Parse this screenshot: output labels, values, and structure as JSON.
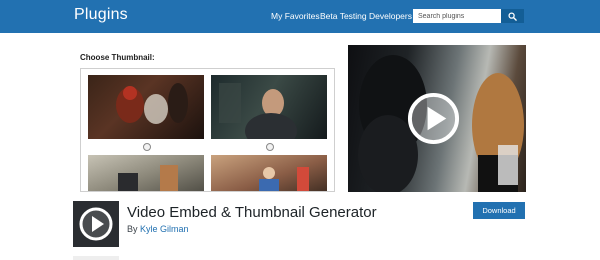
{
  "header": {
    "brand": "Plugins",
    "nav": [
      "My Favorites",
      "Beta Testing",
      "Developers"
    ],
    "search": {
      "placeholder": "Search plugins",
      "value": ""
    },
    "bg_color": "#2271b1",
    "icons": {
      "search_button": "search-icon"
    }
  },
  "banner": {
    "choose_label": "Choose Thumbnail:",
    "icons": {
      "video_overlay": "play-icon"
    }
  },
  "plugin": {
    "title": "Video Embed & Thumbnail Generator",
    "by_prefix": "By",
    "author": "Kyle Gilman",
    "download_label": "Download",
    "accent_color": "#2271b1"
  }
}
